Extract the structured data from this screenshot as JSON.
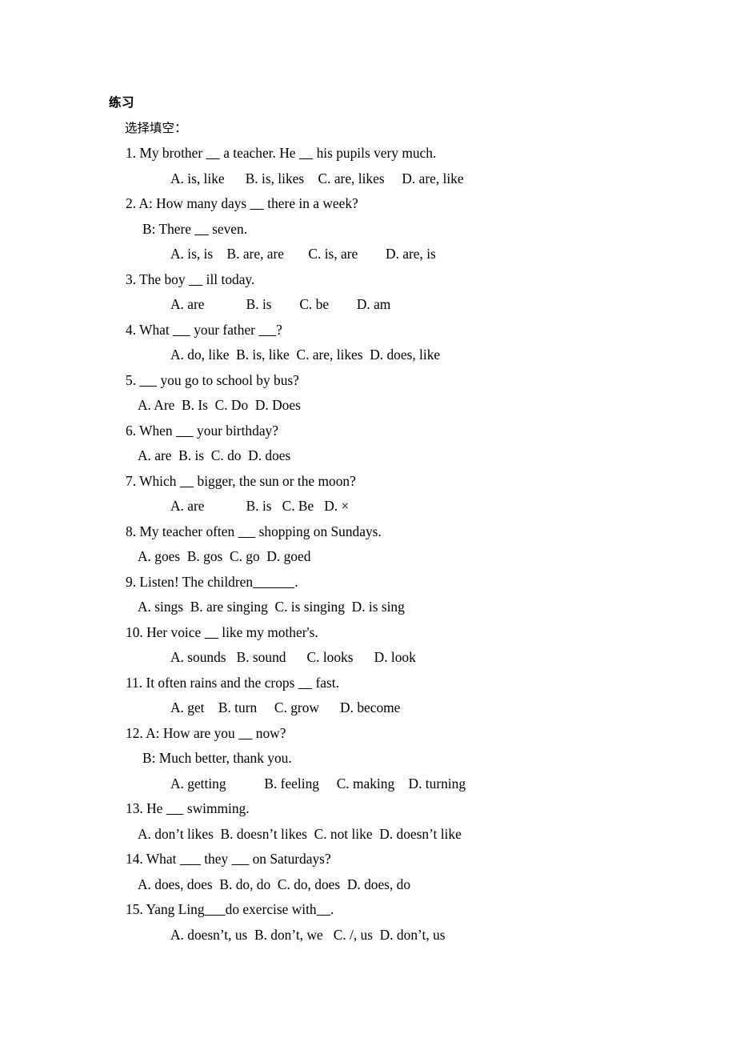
{
  "document": {
    "title": "练习",
    "section_label": "选择填空："
  },
  "questions": [
    {
      "stem": "1. My brother ____ a teacher. He ____ his pupils very much.",
      "options": "A. is, like      B. is, likes    C. are, likes     D. are, like",
      "options_indent": "far"
    },
    {
      "stem": "2. A: How many days ____ there in a week?",
      "sub": "B: There ____ seven.",
      "options": "A. is, is    B. are, are       C. is, are        D. are, is",
      "options_indent": "far"
    },
    {
      "stem": "3. The boy ____ ill today.",
      "options": "A. are            B. is        C. be        D. am",
      "options_indent": "far"
    },
    {
      "stem": "4. What _____ your father _____?",
      "options": "A. do, like  B. is, like  C. are, likes  D. does, like",
      "options_indent": "far"
    },
    {
      "stem": "5. _____ you go to school by bus?",
      "options": "A. Are  B. Is  C. Do  D. Does",
      "options_indent": "near"
    },
    {
      "stem": "6. When _____ your birthday?",
      "options": "A. are  B. is  C. do  D. does",
      "options_indent": "near"
    },
    {
      "stem": "7. Which ____ bigger, the sun or the moon?",
      "options": "A. are            B. is   C. Be   D. ×",
      "options_indent": "far"
    },
    {
      "stem": "8. My teacher often _____ shopping on Sundays.",
      "options": "A. goes  B. gos  C. go  D. goed",
      "options_indent": "near"
    },
    {
      "stem": "9. Listen! The children____________.",
      "options": "A. sings  B. are singing  C. is singing  D. is sing",
      "options_indent": "near"
    },
    {
      "stem": "10. Her voice ____ like my mother's.",
      "options": "A. sounds   B. sound      C. looks      D. look",
      "options_indent": "far"
    },
    {
      "stem": "11. It often rains and the crops ____ fast.",
      "options": "A. get    B. turn     C. grow      D. become",
      "options_indent": "far"
    },
    {
      "stem": "12. A: How are you ____ now?",
      "sub": "B: Much better, thank you.",
      "options": "A. getting           B. feeling     C. making    D. turning",
      "options_indent": "far"
    },
    {
      "stem": "13. He _____ swimming.",
      "options": "A. don’t likes  B. doesn’t likes  C. not like  D. doesn’t like",
      "options_indent": "near"
    },
    {
      "stem": "14. What ______ they _____ on Saturdays?",
      "options": "A. does, does  B. do, do  C. do, does  D. does, do",
      "options_indent": "near"
    },
    {
      "stem": "15. Yang Ling______do exercise with____.",
      "options": "A. doesn’t, us  B. don’t, we   C. /, us  D. don’t, us",
      "options_indent": "far"
    }
  ]
}
